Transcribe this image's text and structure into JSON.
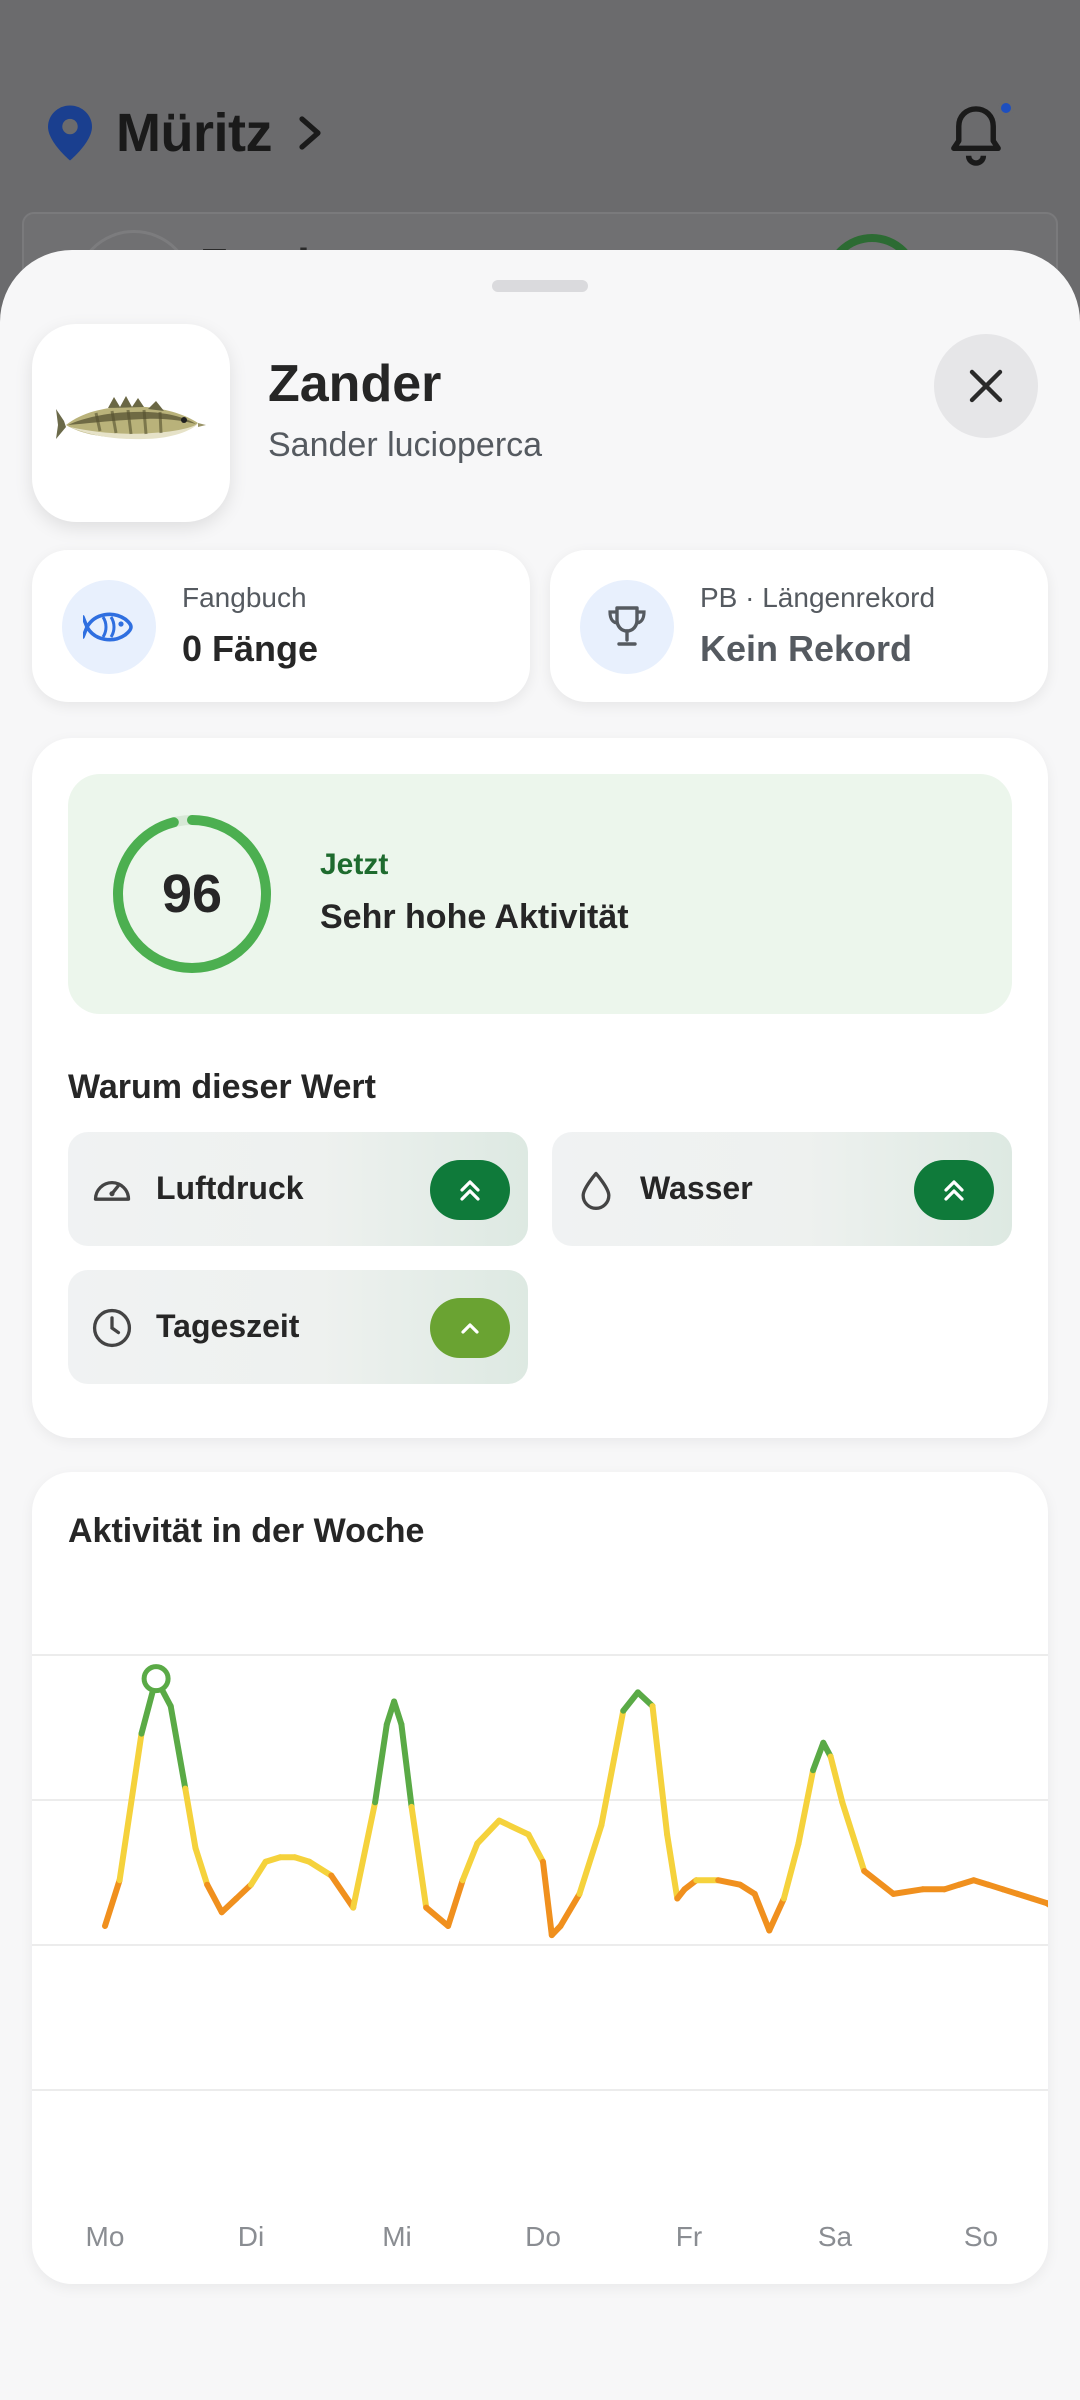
{
  "background": {
    "location_title": "Müritz",
    "card_text": "Zand"
  },
  "sheet": {
    "species_name": "Zander",
    "species_latin": "Sander lucioperca",
    "stats": [
      {
        "label": "Fangbuch",
        "value": "0 Fänge",
        "icon": "fish-icon"
      },
      {
        "label": "PB · Längenrekord",
        "value": "Kein Rekord",
        "icon": "trophy-icon"
      }
    ],
    "now": {
      "score": "96",
      "score_fraction": 0.96,
      "label": "Jetzt",
      "text": "Sehr hohe Aktivität"
    },
    "why_title": "Warum dieser Wert",
    "factors": [
      {
        "label": "Luftdruck",
        "icon": "gauge-icon",
        "level": "double-up"
      },
      {
        "label": "Wasser",
        "icon": "water-drop-icon",
        "level": "double-up"
      },
      {
        "label": "Tageszeit",
        "icon": "clock-icon",
        "level": "up"
      }
    ],
    "week_title": "Aktivität in der Woche"
  },
  "colors": {
    "high": "#5aaa46",
    "mid": "#f5d23c",
    "low": "#f0901e",
    "pill_high": "#0f7a3a",
    "pill_mid": "#6aa332",
    "accent_blue": "#2f6fe0"
  },
  "chart_data": {
    "type": "line",
    "categories": [
      "Mo",
      "Di",
      "Mi",
      "Do",
      "Fr",
      "Sa",
      "So"
    ],
    "ylim": [
      0,
      100
    ],
    "grid": true,
    "x": [
      0.0,
      0.1,
      0.25,
      0.35,
      0.45,
      0.55,
      0.62,
      0.7,
      0.8,
      0.9,
      1.0,
      1.1,
      1.2,
      1.3,
      1.4,
      1.55,
      1.7,
      1.85,
      1.93,
      1.98,
      2.03,
      2.1,
      2.2,
      2.35,
      2.45,
      2.55,
      2.7,
      2.9,
      3.0,
      3.06,
      3.12,
      3.25,
      3.4,
      3.55,
      3.65,
      3.75,
      3.85,
      3.92,
      3.97,
      4.05,
      4.2,
      4.35,
      4.45,
      4.55,
      4.65,
      4.75,
      4.85,
      4.92,
      4.97,
      5.05,
      5.2,
      5.4,
      5.6,
      5.75,
      5.85,
      5.95,
      6.05,
      6.15,
      6.25,
      6.35,
      6.45,
      6.55,
      6.65,
      6.75,
      6.8
    ],
    "y": [
      38,
      48,
      80,
      92,
      86,
      68,
      55,
      47,
      41,
      44,
      47,
      52,
      53,
      53,
      52,
      49,
      42,
      65,
      82,
      87,
      82,
      64,
      42,
      38,
      48,
      56,
      61,
      58,
      52,
      36,
      38,
      45,
      60,
      85,
      89,
      86,
      58,
      44,
      46,
      48,
      48,
      47,
      45,
      37,
      44,
      56,
      72,
      78,
      75,
      65,
      50,
      45,
      46,
      46,
      47,
      48,
      47,
      46,
      45,
      44,
      43,
      41,
      42,
      44,
      44
    ],
    "marker_index": 3,
    "bands": {
      "high_above": 73,
      "low_below": 48
    }
  }
}
